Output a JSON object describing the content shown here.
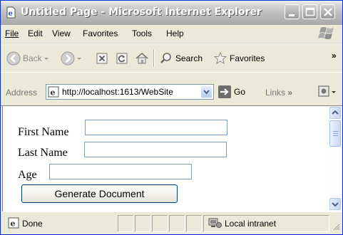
{
  "window": {
    "title": "Untitled Page - Microsoft Internet Explorer"
  },
  "menu": {
    "items": [
      {
        "label": "File"
      },
      {
        "label": "Edit"
      },
      {
        "label": "View"
      },
      {
        "label": "Favorites"
      },
      {
        "label": "Tools"
      },
      {
        "label": "Help"
      }
    ]
  },
  "toolbar": {
    "back_label": "Back",
    "search_label": "Search",
    "favorites_label": "Favorites",
    "overflow": "»"
  },
  "address": {
    "label": "Address",
    "url": "http://localhost:1613/WebSite",
    "go_label": "Go",
    "links_label": "Links",
    "links_chevron": "»"
  },
  "form": {
    "first_name_label": "First Name",
    "first_name_value": "",
    "last_name_label": "Last Name",
    "last_name_value": "",
    "age_label": "Age",
    "age_value": "",
    "button_label": "Generate Document"
  },
  "status": {
    "text": "Done",
    "zone": "Local intranet"
  },
  "colors": {
    "title_gradient_top": "#d4d4d4",
    "content_bg": "#ffffff",
    "chrome": "#ece9d8",
    "input_border": "#7f9db9"
  }
}
